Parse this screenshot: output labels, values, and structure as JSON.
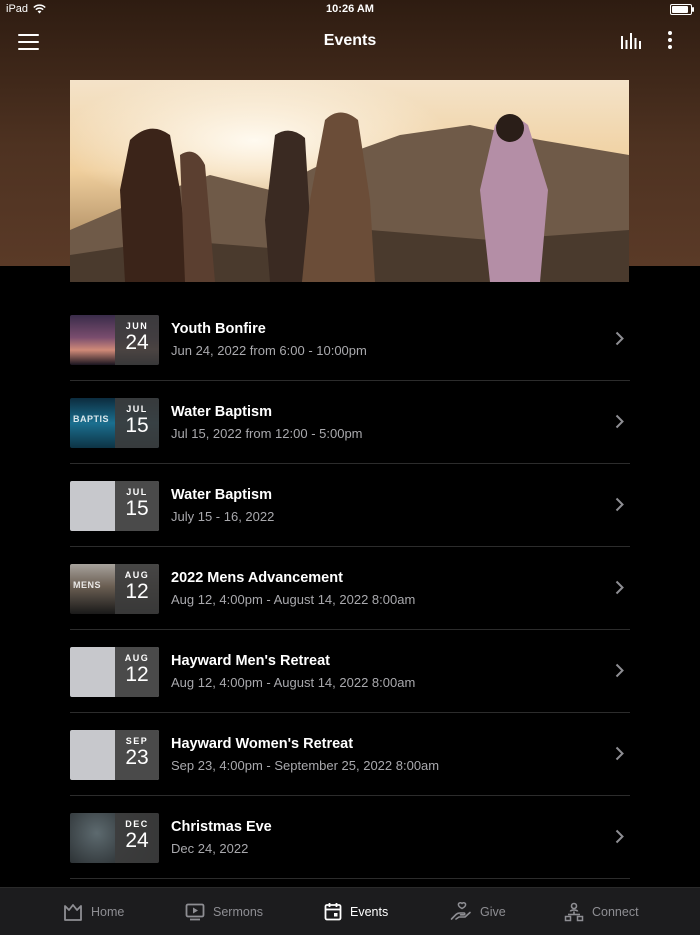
{
  "status_bar": {
    "device": "iPad",
    "time": "10:26 AM"
  },
  "nav": {
    "title": "Events"
  },
  "events": [
    {
      "title": "Youth Bonfire",
      "when": "Jun 24, 2022 from 6:00 - 10:00pm",
      "month": "JUN",
      "day": "24"
    },
    {
      "title": "Water Baptism",
      "when": "Jul 15, 2022 from 12:00 - 5:00pm",
      "month": "JUL",
      "day": "15"
    },
    {
      "title": "Water Baptism",
      "when": "July 15 - 16, 2022",
      "month": "JUL",
      "day": "15"
    },
    {
      "title": "2022 Mens Advancement",
      "when": "Aug 12, 4:00pm - August 14, 2022 8:00am",
      "month": "AUG",
      "day": "12"
    },
    {
      "title": "Hayward Men's Retreat",
      "when": "Aug 12, 4:00pm - August 14, 2022 8:00am",
      "month": "AUG",
      "day": "12"
    },
    {
      "title": "Hayward Women's Retreat",
      "when": "Sep 23, 4:00pm - September 25, 2022 8:00am",
      "month": "SEP",
      "day": "23"
    },
    {
      "title": "Christmas Eve",
      "when": "Dec 24, 2022",
      "month": "DEC",
      "day": "24"
    }
  ],
  "thumb_text": {
    "baptism": "BAPTIS",
    "mens": "MENS"
  },
  "tabs": [
    {
      "label": "Home",
      "icon": "home-icon"
    },
    {
      "label": "Sermons",
      "icon": "play-screen-icon"
    },
    {
      "label": "Events",
      "icon": "calendar-icon"
    },
    {
      "label": "Give",
      "icon": "give-hand-icon"
    },
    {
      "label": "Connect",
      "icon": "connect-network-icon"
    }
  ],
  "colors": {
    "accent_brown": "#5a3a27",
    "tab_active": "#ffffff",
    "tab_inactive": "#8e8e93"
  }
}
